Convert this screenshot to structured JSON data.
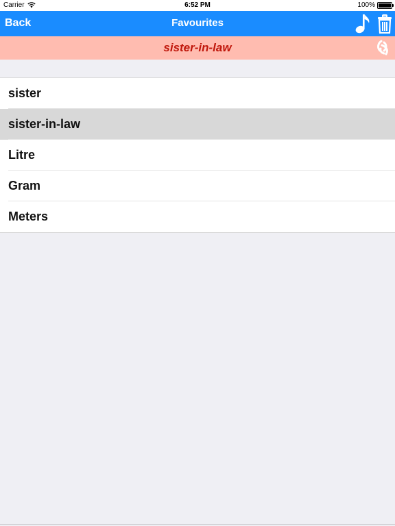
{
  "status_bar": {
    "carrier": "Carrier",
    "time": "6:52 PM",
    "battery": "100%"
  },
  "nav": {
    "back_label": "Back",
    "title": "Favourites",
    "music_icon": "music-note-icon",
    "trash_icon": "trash-icon"
  },
  "banner": {
    "word": "sister-in-law",
    "translate_icon": "translate-icon"
  },
  "favourites": [
    {
      "label": "sister",
      "selected": false
    },
    {
      "label": "sister-in-law",
      "selected": true
    },
    {
      "label": "Litre",
      "selected": false
    },
    {
      "label": "Gram",
      "selected": false
    },
    {
      "label": "Meters",
      "selected": false
    }
  ],
  "colors": {
    "nav_bg": "#1a8cff",
    "banner_bg": "#ffbcb0",
    "banner_text": "#c0180c",
    "selected_row": "#d8d8d8",
    "page_bg": "#efeff4"
  }
}
